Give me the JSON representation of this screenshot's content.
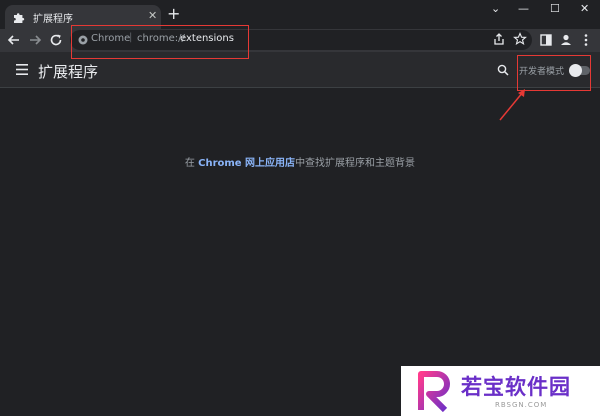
{
  "tab": {
    "title": "扩展程序",
    "favicon": "puzzle-icon",
    "close_label": "✕",
    "new_tab_label": "+"
  },
  "window_controls": {
    "chevron": "⌄",
    "minimize": "—",
    "maximize": "☐",
    "close": "✕"
  },
  "omnibox": {
    "origin": "Chrome",
    "separator": "|",
    "scheme": "chrome://",
    "path": "extensions"
  },
  "header": {
    "title": "扩展程序",
    "developer_mode_label": "开发者模式",
    "developer_mode_on": false
  },
  "content": {
    "prefix": "在 ",
    "link": "Chrome 网上应用店",
    "suffix": "中查找扩展程序和主题背景"
  },
  "watermark": {
    "name": "若宝软件园",
    "url": "RBSGN.COM"
  },
  "colors": {
    "background": "#202124",
    "toolbar": "#35363a",
    "header": "#292a2d",
    "link": "#8ab4f8",
    "annotation": "#e53935",
    "watermark_text": "#6a2fc8"
  }
}
